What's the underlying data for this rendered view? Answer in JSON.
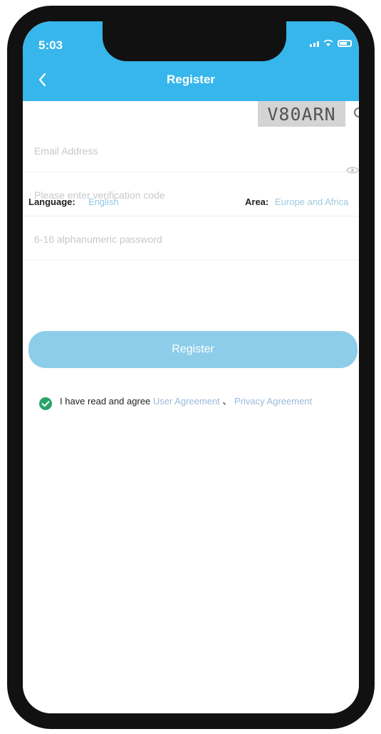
{
  "status": {
    "time": "5:03"
  },
  "header": {
    "title": "Register",
    "back_icon": "back-icon"
  },
  "form": {
    "email_placeholder": "Email Address",
    "verification_placeholder": "Please enter verification code",
    "captcha_text": "V80ARN",
    "password_placeholder": "6-16 alphanumeric password"
  },
  "settings": {
    "language_label": "Language:",
    "language_value": "English",
    "area_label": "Area:",
    "area_value": "Europe and Africa"
  },
  "actions": {
    "register_label": "Register"
  },
  "agreement": {
    "prefix": "I have read and agree",
    "user_agreement": "User Agreement",
    "separator": "、",
    "privacy_agreement": "Privacy Agreement"
  },
  "colors": {
    "accent": "#36b6ea",
    "register_button": "#8dcde9",
    "success": "#2aa36b"
  }
}
